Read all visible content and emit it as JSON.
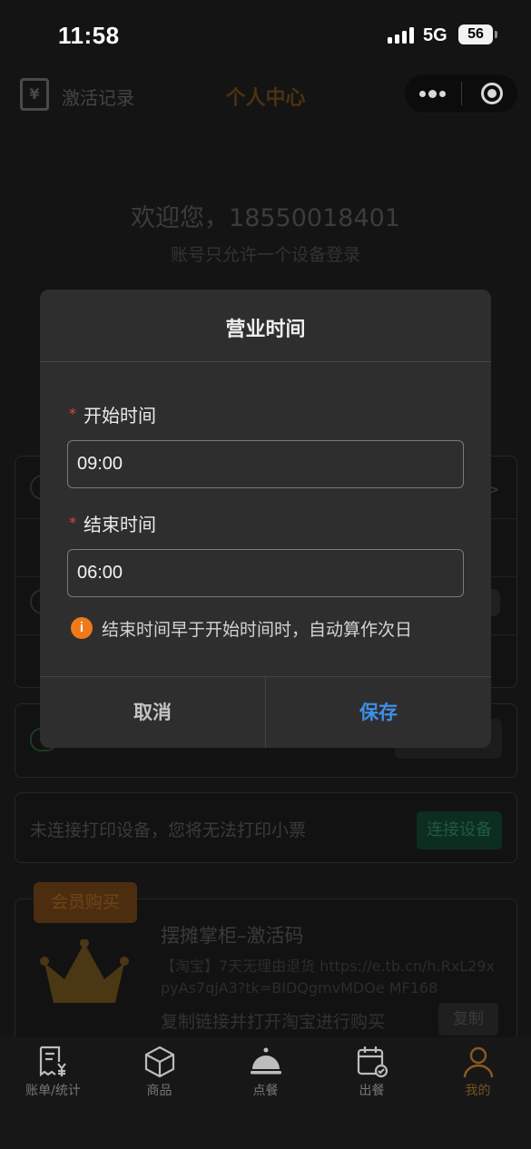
{
  "status_bar": {
    "time": "11:58",
    "network": "5G",
    "battery": "56"
  },
  "nav": {
    "left_label": "激活记录",
    "left_icon": "clipboard-yen-icon",
    "title": "个人中心"
  },
  "profile": {
    "welcome": "欢迎您，18550018401",
    "subtitle": "账号只允许一个设备登录"
  },
  "printer": {
    "message": "未连接打印设备，您将无法打印小票",
    "connect_label": "连接设备"
  },
  "member": {
    "badge": "会员购买",
    "title": "摆摊掌柜–激活码",
    "link": "【淘宝】7天无理由退货 https://e.tb.cn/h.RxL29xpyAs7qjA3?tk=BIDQgmvMDOe MF168",
    "copy_tip": "复制链接并打开淘宝进行购买",
    "copy_label": "复制"
  },
  "modal": {
    "title": "营业时间",
    "required_mark": "*",
    "start_label": "开始时间",
    "start_value": "09:00",
    "end_label": "结束时间",
    "end_value": "06:00",
    "tip": "结束时间早于开始时间时，自动算作次日",
    "tip_icon": "info-icon",
    "cancel_label": "取消",
    "save_label": "保存"
  },
  "tabs": [
    {
      "label": "账单/统计",
      "icon": "receipt-icon",
      "active": false
    },
    {
      "label": "商品",
      "icon": "box-icon",
      "active": false
    },
    {
      "label": "点餐",
      "icon": "cloche-icon",
      "active": false
    },
    {
      "label": "出餐",
      "icon": "calendar-check-icon",
      "active": false
    },
    {
      "label": "我的",
      "icon": "user-icon",
      "active": true
    }
  ],
  "colors": {
    "accent": "#f08c2a",
    "primary_blue": "#3f8ee8",
    "required_red": "#e64340",
    "tip_orange": "#f07a1a"
  }
}
